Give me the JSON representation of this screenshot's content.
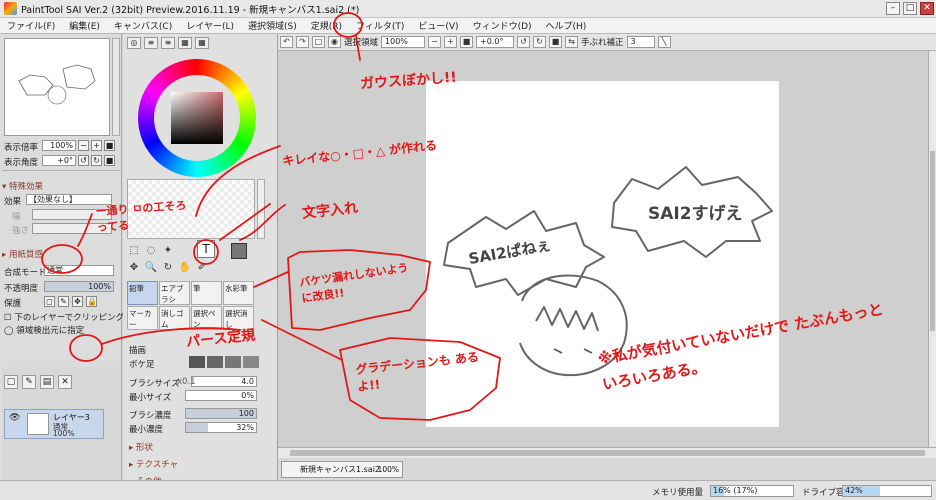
{
  "window": {
    "title": "PaintTool SAI Ver.2 (32bit) Preview.2016.11.19 - 新規キャンバス1.sai2 (*)"
  },
  "menu": [
    "ファイル(F)",
    "編集(E)",
    "キャンバス(C)",
    "レイヤー(L)",
    "選択領域(S)",
    "定規(R)",
    "フィルタ(T)",
    "ビュー(V)",
    "ウィンドウ(D)",
    "ヘルプ(H)"
  ],
  "toolbar": {
    "selection_label": "選択領域",
    "zoom": "100%",
    "angle": "+0.0°",
    "stabilizer_label": "手ぶれ補正",
    "stabilizer_value": "3"
  },
  "left": {
    "zoom_label": "表示倍率",
    "zoom_value": "100%",
    "angle_label": "表示角度",
    "angle_value": "+0°",
    "effects_section": "特殊効果",
    "effect_label": "効果",
    "effect_value": "【効果なし】",
    "width_label": "幅",
    "strength_label": "強さ",
    "paper_section": "用紙質感",
    "blend_label": "合成モード",
    "blend_value": "通常",
    "opacity_label": "不透明度",
    "opacity_value": "100%",
    "protect_label": "保護",
    "clip_label": "下のレイヤーでクリッピング",
    "source_label": "領域検出元に指定"
  },
  "layer": {
    "name": "レイヤー3",
    "mode": "通常",
    "opacity": "100%"
  },
  "brushes": [
    {
      "label": "鉛筆",
      "selected": true
    },
    {
      "label": "エアブラシ",
      "selected": false
    },
    {
      "label": "筆",
      "selected": false
    },
    {
      "label": "水彩筆",
      "selected": false
    },
    {
      "label": "マーカー",
      "selected": false
    },
    {
      "label": "消しゴム",
      "selected": false
    },
    {
      "label": "選択ペン",
      "selected": false
    },
    {
      "label": "選択消し",
      "selected": false
    }
  ],
  "props": {
    "edge_label": "描画",
    "blur_label": "ボケ足",
    "size_label": "ブラシサイズ",
    "size_mult": "x0.1",
    "size_value": "4.0",
    "minsize_label": "最小サイズ",
    "minsize_value": "0%",
    "density_label": "ブラシ濃度",
    "density_value": "100",
    "density_fraction": 1.0,
    "mindensity_label": "最小濃度",
    "mindensity_value": "32%",
    "mindensity_fraction": 0.32,
    "shape_section": "形状",
    "texture_section": "テクスチャ",
    "misc_section": "その他"
  },
  "tab": {
    "name": "新規キャンバス1.sai2",
    "zoom": "100%"
  },
  "status": {
    "memory_label": "メモリ使用量",
    "memory_value": "16% (17%)",
    "memory_fraction": 0.16,
    "drive_label": "ドライブ容量",
    "drive_value": "42%",
    "drive_fraction": 0.42
  },
  "annotations": {
    "filter_note": "ガウスぼかし!!",
    "shapes_note": "キレイな○・□・△ が作れる",
    "text_note": "文字入れ",
    "effects_note": "ー通り ㅁの工そろってる",
    "fill_note": "バケツ漏れしないように改良!!",
    "perspective_note": "パース定規",
    "gradient_note": "グラデーションも あるよ!!",
    "footnote": "※私が気付いていないだけで たぶんもっといろいろある。",
    "bubble_left": "SAI2ぱねぇ",
    "bubble_right": "SAI2すげえ"
  },
  "colors": {
    "annotation": "#e01818",
    "layer_sel": "#c9d7ec",
    "canvas_bg": "#cfcfcf"
  }
}
